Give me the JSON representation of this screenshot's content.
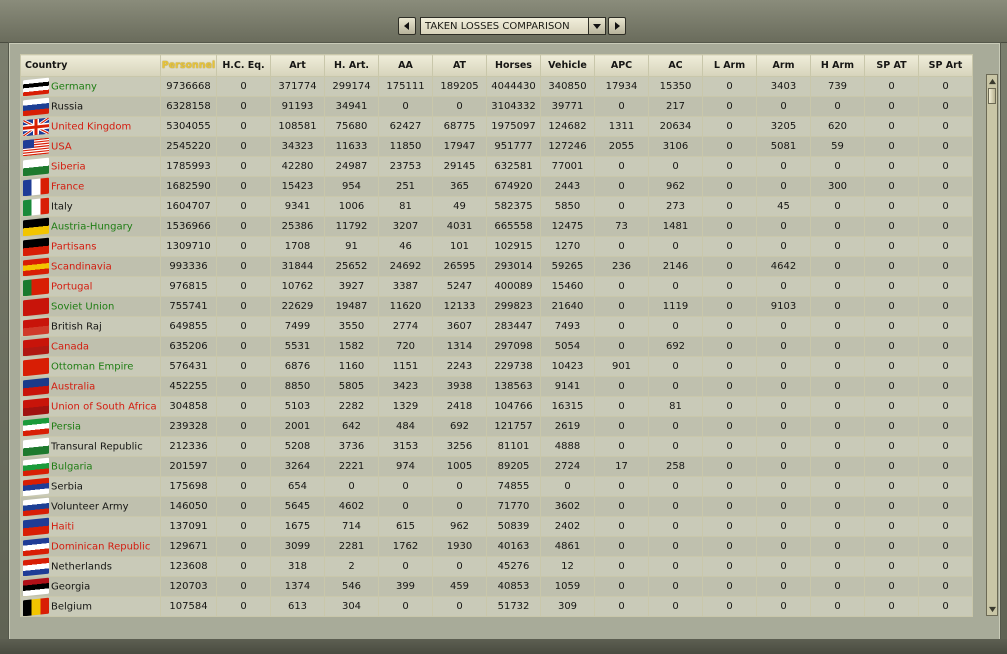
{
  "window": {
    "report_selector": {
      "value": "TAKEN LOSSES COMPARISON"
    }
  },
  "table": {
    "columns": [
      "Country",
      "Personnel",
      "H.C. Eq.",
      "Art",
      "H. Art.",
      "AA",
      "AT",
      "Horses",
      "Vehicle",
      "APC",
      "AC",
      "L Arm",
      "Arm",
      "H Arm",
      "SP AT",
      "SP Art"
    ],
    "sorted_column": 1,
    "rows": [
      {
        "country": "Germany",
        "color": "green",
        "flag": [
          "#ffffff",
          "#000000",
          "#ffffff",
          "#d81e05"
        ],
        "values": [
          "9736668",
          "0",
          "371774",
          "299174",
          "175111",
          "189205",
          "4044430",
          "340850",
          "17934",
          "15350",
          "0",
          "3403",
          "739",
          "0",
          "0"
        ]
      },
      {
        "country": "Russia",
        "color": "black",
        "flag": [
          "#ffffff",
          "#1c3f94",
          "#d81e05"
        ],
        "values": [
          "6328158",
          "0",
          "91193",
          "34941",
          "0",
          "0",
          "3104332",
          "39771",
          "0",
          "217",
          "0",
          "0",
          "0",
          "0",
          "0"
        ]
      },
      {
        "country": "United Kingdom",
        "color": "red",
        "flag": [
          "uk"
        ],
        "values": [
          "5304055",
          "0",
          "108581",
          "75680",
          "62427",
          "68775",
          "1975097",
          "124682",
          "1311",
          "20634",
          "0",
          "3205",
          "620",
          "0",
          "0"
        ]
      },
      {
        "country": "USA",
        "color": "red",
        "flag": [
          "usa"
        ],
        "values": [
          "2545220",
          "0",
          "34323",
          "11633",
          "11850",
          "17947",
          "951777",
          "127246",
          "2055",
          "3106",
          "0",
          "5081",
          "59",
          "0",
          "0"
        ]
      },
      {
        "country": "Siberia",
        "color": "red",
        "flag": [
          "#ffffff",
          "#1e7a2e"
        ],
        "values": [
          "1785993",
          "0",
          "42280",
          "24987",
          "23753",
          "29145",
          "632581",
          "77001",
          "0",
          "0",
          "0",
          "0",
          "0",
          "0",
          "0"
        ]
      },
      {
        "country": "France",
        "color": "red",
        "flag": [
          "v",
          "#1f3c96",
          "#ffffff",
          "#d81e05"
        ],
        "values": [
          "1682590",
          "0",
          "15423",
          "954",
          "251",
          "365",
          "674920",
          "2443",
          "0",
          "962",
          "0",
          "0",
          "300",
          "0",
          "0"
        ]
      },
      {
        "country": "Italy",
        "color": "black",
        "flag": [
          "v",
          "#1a8a3a",
          "#ffffff",
          "#d81e05"
        ],
        "values": [
          "1604707",
          "0",
          "9341",
          "1006",
          "81",
          "49",
          "582375",
          "5850",
          "0",
          "273",
          "0",
          "45",
          "0",
          "0",
          "0"
        ]
      },
      {
        "country": "Austria-Hungary",
        "color": "green",
        "flag": [
          "#000000",
          "#f2c500"
        ],
        "values": [
          "1536966",
          "0",
          "25386",
          "11792",
          "3207",
          "4031",
          "665558",
          "12475",
          "73",
          "1481",
          "0",
          "0",
          "0",
          "0",
          "0"
        ]
      },
      {
        "country": "Partisans",
        "color": "red",
        "flag": [
          "#000000",
          "#d81e05"
        ],
        "values": [
          "1309710",
          "0",
          "1708",
          "91",
          "46",
          "101",
          "102915",
          "1270",
          "0",
          "0",
          "0",
          "0",
          "0",
          "0",
          "0"
        ]
      },
      {
        "country": "Scandinavia",
        "color": "red",
        "flag": [
          "#d81e05",
          "#f2c500",
          "#d81e05"
        ],
        "values": [
          "993336",
          "0",
          "31844",
          "25652",
          "24692",
          "26595",
          "293014",
          "59265",
          "236",
          "2146",
          "0",
          "4642",
          "0",
          "0",
          "0"
        ]
      },
      {
        "country": "Portugal",
        "color": "red",
        "flag": [
          "v",
          "#1a7a2e",
          "#d81e05",
          "#d81e05"
        ],
        "values": [
          "976815",
          "0",
          "10762",
          "3927",
          "3387",
          "5247",
          "400089",
          "15460",
          "0",
          "0",
          "0",
          "0",
          "0",
          "0",
          "0"
        ]
      },
      {
        "country": "Soviet Union",
        "color": "green",
        "flag": [
          "#c8140a"
        ],
        "values": [
          "755741",
          "0",
          "22629",
          "19487",
          "11620",
          "12133",
          "299823",
          "21640",
          "0",
          "1119",
          "0",
          "9103",
          "0",
          "0",
          "0"
        ]
      },
      {
        "country": "British Raj",
        "color": "black",
        "flag": [
          "#c8140a",
          "#d03a2a"
        ],
        "values": [
          "649855",
          "0",
          "7499",
          "3550",
          "2774",
          "3607",
          "283447",
          "7493",
          "0",
          "0",
          "0",
          "0",
          "0",
          "0",
          "0"
        ]
      },
      {
        "country": "Canada",
        "color": "red",
        "flag": [
          "#c8140a",
          "#b01812"
        ],
        "values": [
          "635206",
          "0",
          "5531",
          "1582",
          "720",
          "1314",
          "297098",
          "5054",
          "0",
          "692",
          "0",
          "0",
          "0",
          "0",
          "0"
        ]
      },
      {
        "country": "Ottoman Empire",
        "color": "green",
        "flag": [
          "#d81e05"
        ],
        "values": [
          "576431",
          "0",
          "6876",
          "1160",
          "1151",
          "2243",
          "229738",
          "10423",
          "901",
          "0",
          "0",
          "0",
          "0",
          "0",
          "0"
        ]
      },
      {
        "country": "Australia",
        "color": "red",
        "flag": [
          "#1a3a8a",
          "#c8140a"
        ],
        "values": [
          "452255",
          "0",
          "8850",
          "5805",
          "3423",
          "3938",
          "138563",
          "9141",
          "0",
          "0",
          "0",
          "0",
          "0",
          "0",
          "0"
        ]
      },
      {
        "country": "Union of South Africa",
        "color": "red",
        "flag": [
          "#c8140a",
          "#a01210"
        ],
        "values": [
          "304858",
          "0",
          "5103",
          "2282",
          "1329",
          "2418",
          "104766",
          "16315",
          "0",
          "81",
          "0",
          "0",
          "0",
          "0",
          "0"
        ]
      },
      {
        "country": "Persia",
        "color": "green",
        "flag": [
          "#1a9a3a",
          "#ffffff",
          "#d81e05"
        ],
        "values": [
          "239328",
          "0",
          "2001",
          "642",
          "484",
          "692",
          "121757",
          "2619",
          "0",
          "0",
          "0",
          "0",
          "0",
          "0",
          "0"
        ]
      },
      {
        "country": "Transural Republic",
        "color": "black",
        "flag": [
          "#ffffff",
          "#1e7a2e"
        ],
        "values": [
          "212336",
          "0",
          "5208",
          "3736",
          "3153",
          "3256",
          "81101",
          "4888",
          "0",
          "0",
          "0",
          "0",
          "0",
          "0",
          "0"
        ]
      },
      {
        "country": "Bulgaria",
        "color": "green",
        "flag": [
          "#ffffff",
          "#1a9a3a",
          "#d81e05"
        ],
        "values": [
          "201597",
          "0",
          "3264",
          "2221",
          "974",
          "1005",
          "89205",
          "2724",
          "17",
          "258",
          "0",
          "0",
          "0",
          "0",
          "0"
        ]
      },
      {
        "country": "Serbia",
        "color": "black",
        "flag": [
          "#d81e05",
          "#1f3c96",
          "#ffffff"
        ],
        "values": [
          "175698",
          "0",
          "654",
          "0",
          "0",
          "0",
          "74855",
          "0",
          "0",
          "0",
          "0",
          "0",
          "0",
          "0",
          "0"
        ]
      },
      {
        "country": "Volunteer Army",
        "color": "black",
        "flag": [
          "#ffffff",
          "#1c3f94",
          "#d81e05"
        ],
        "values": [
          "146050",
          "0",
          "5645",
          "4602",
          "0",
          "0",
          "71770",
          "3602",
          "0",
          "0",
          "0",
          "0",
          "0",
          "0",
          "0"
        ]
      },
      {
        "country": "Haiti",
        "color": "red",
        "flag": [
          "#1f3c96",
          "#d81e05"
        ],
        "values": [
          "137091",
          "0",
          "1675",
          "714",
          "615",
          "962",
          "50839",
          "2402",
          "0",
          "0",
          "0",
          "0",
          "0",
          "0",
          "0"
        ]
      },
      {
        "country": "Dominican Republic",
        "color": "red",
        "flag": [
          "#1f3c96",
          "#ffffff",
          "#d81e05"
        ],
        "values": [
          "129671",
          "0",
          "3099",
          "2281",
          "1762",
          "1930",
          "40163",
          "4861",
          "0",
          "0",
          "0",
          "0",
          "0",
          "0",
          "0"
        ]
      },
      {
        "country": "Netherlands",
        "color": "black",
        "flag": [
          "#d81e05",
          "#ffffff",
          "#1f3c96"
        ],
        "values": [
          "123608",
          "0",
          "318",
          "2",
          "0",
          "0",
          "45276",
          "12",
          "0",
          "0",
          "0",
          "0",
          "0",
          "0",
          "0"
        ]
      },
      {
        "country": "Georgia",
        "color": "black",
        "flag": [
          "#b01018",
          "#000000",
          "#ffffff"
        ],
        "values": [
          "120703",
          "0",
          "1374",
          "546",
          "399",
          "459",
          "40853",
          "1059",
          "0",
          "0",
          "0",
          "0",
          "0",
          "0",
          "0"
        ]
      },
      {
        "country": "Belgium",
        "color": "black",
        "flag": [
          "v",
          "#000000",
          "#f2c500",
          "#d81e05"
        ],
        "values": [
          "107584",
          "0",
          "613",
          "304",
          "0",
          "0",
          "51732",
          "309",
          "0",
          "0",
          "0",
          "0",
          "0",
          "0",
          "0"
        ]
      }
    ]
  }
}
